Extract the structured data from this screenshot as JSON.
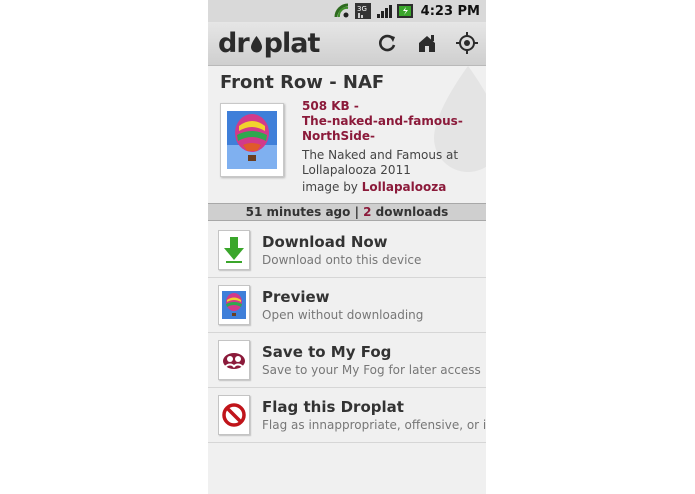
{
  "status_bar": {
    "time": "4:23 PM",
    "network": "3G"
  },
  "app_bar": {
    "logo_left": "dr",
    "logo_right": "plat",
    "actions": [
      {
        "icon": "refresh-icon"
      },
      {
        "icon": "home-icon"
      },
      {
        "icon": "locate-icon"
      }
    ]
  },
  "droplet": {
    "title": "Front Row - NAF",
    "size": "508 KB",
    "separator": " - ",
    "filename": "The-naked-and-famous-NorthSide-",
    "description": "The Naked and Famous at Lollapalooza 2011",
    "by_prefix": "image by ",
    "author": "Lollapalooza"
  },
  "meta": {
    "time_ago": "51 minutes ago",
    "sep": " | ",
    "downloads_count": "2",
    "downloads_label": " downloads"
  },
  "actions": [
    {
      "title": "Download Now",
      "subtitle": "Download onto this device",
      "icon": "download-icon"
    },
    {
      "title": "Preview",
      "subtitle": "Open without downloading",
      "icon": "preview-icon"
    },
    {
      "title": "Save to My Fog",
      "subtitle": "Save to your My Fog for later access",
      "icon": "fog-icon"
    },
    {
      "title": "Flag this Droplat",
      "subtitle": "Flag as innappropriate, offensive, or illegal",
      "icon": "flag-icon"
    }
  ],
  "colors": {
    "accent": "#8b1a3a",
    "download_green": "#3aa62b",
    "flag_red": "#c0141a"
  }
}
